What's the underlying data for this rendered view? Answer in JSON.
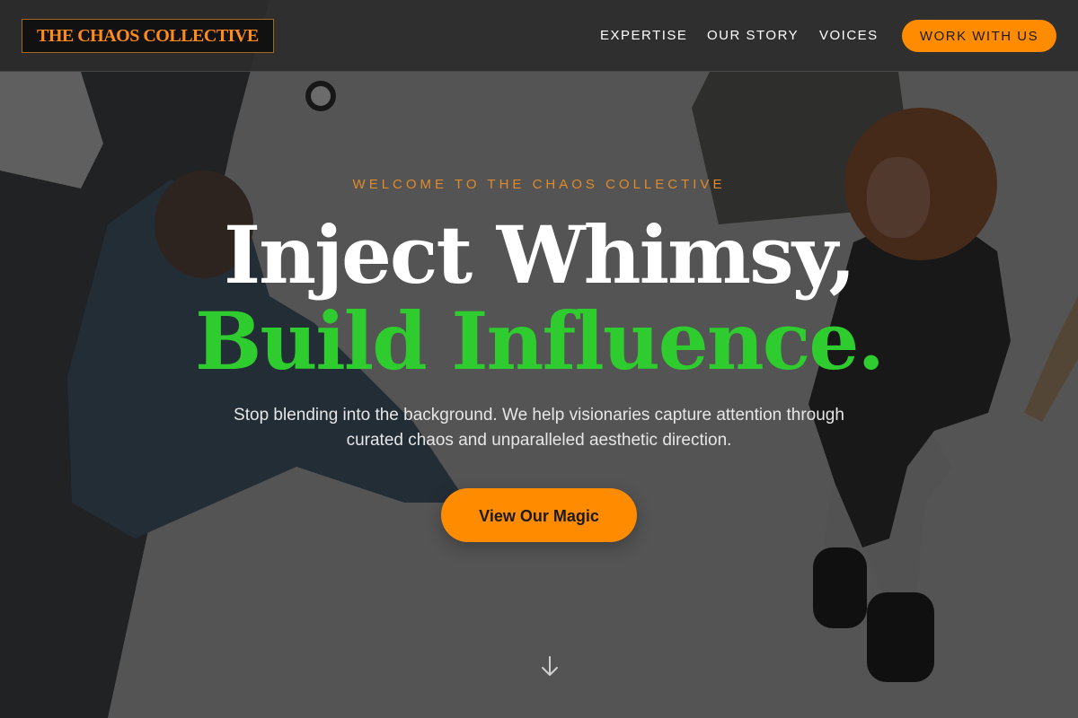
{
  "brand": {
    "logo_text": "THE CHAOS COLLECTIVE"
  },
  "nav": {
    "items": [
      {
        "label": "EXPERTISE"
      },
      {
        "label": "OUR STORY"
      },
      {
        "label": "VOICES"
      }
    ],
    "cta_label": "WORK WITH US"
  },
  "hero": {
    "eyebrow": "WELCOME TO THE CHAOS COLLECTIVE",
    "headline_line1": "Inject Whimsy,",
    "headline_line2": "Build Influence.",
    "subtitle": "Stop blending into the background. We help visionaries capture attention through curated chaos and unparalleled aesthetic direction.",
    "cta_label": "View Our Magic",
    "scroll_icon": "arrow-down-icon"
  },
  "colors": {
    "accent_orange": "#ff8c00",
    "headline_green": "#2ecc2e",
    "header_bg": "#2c2c2c",
    "logo_bg": "#111111"
  }
}
